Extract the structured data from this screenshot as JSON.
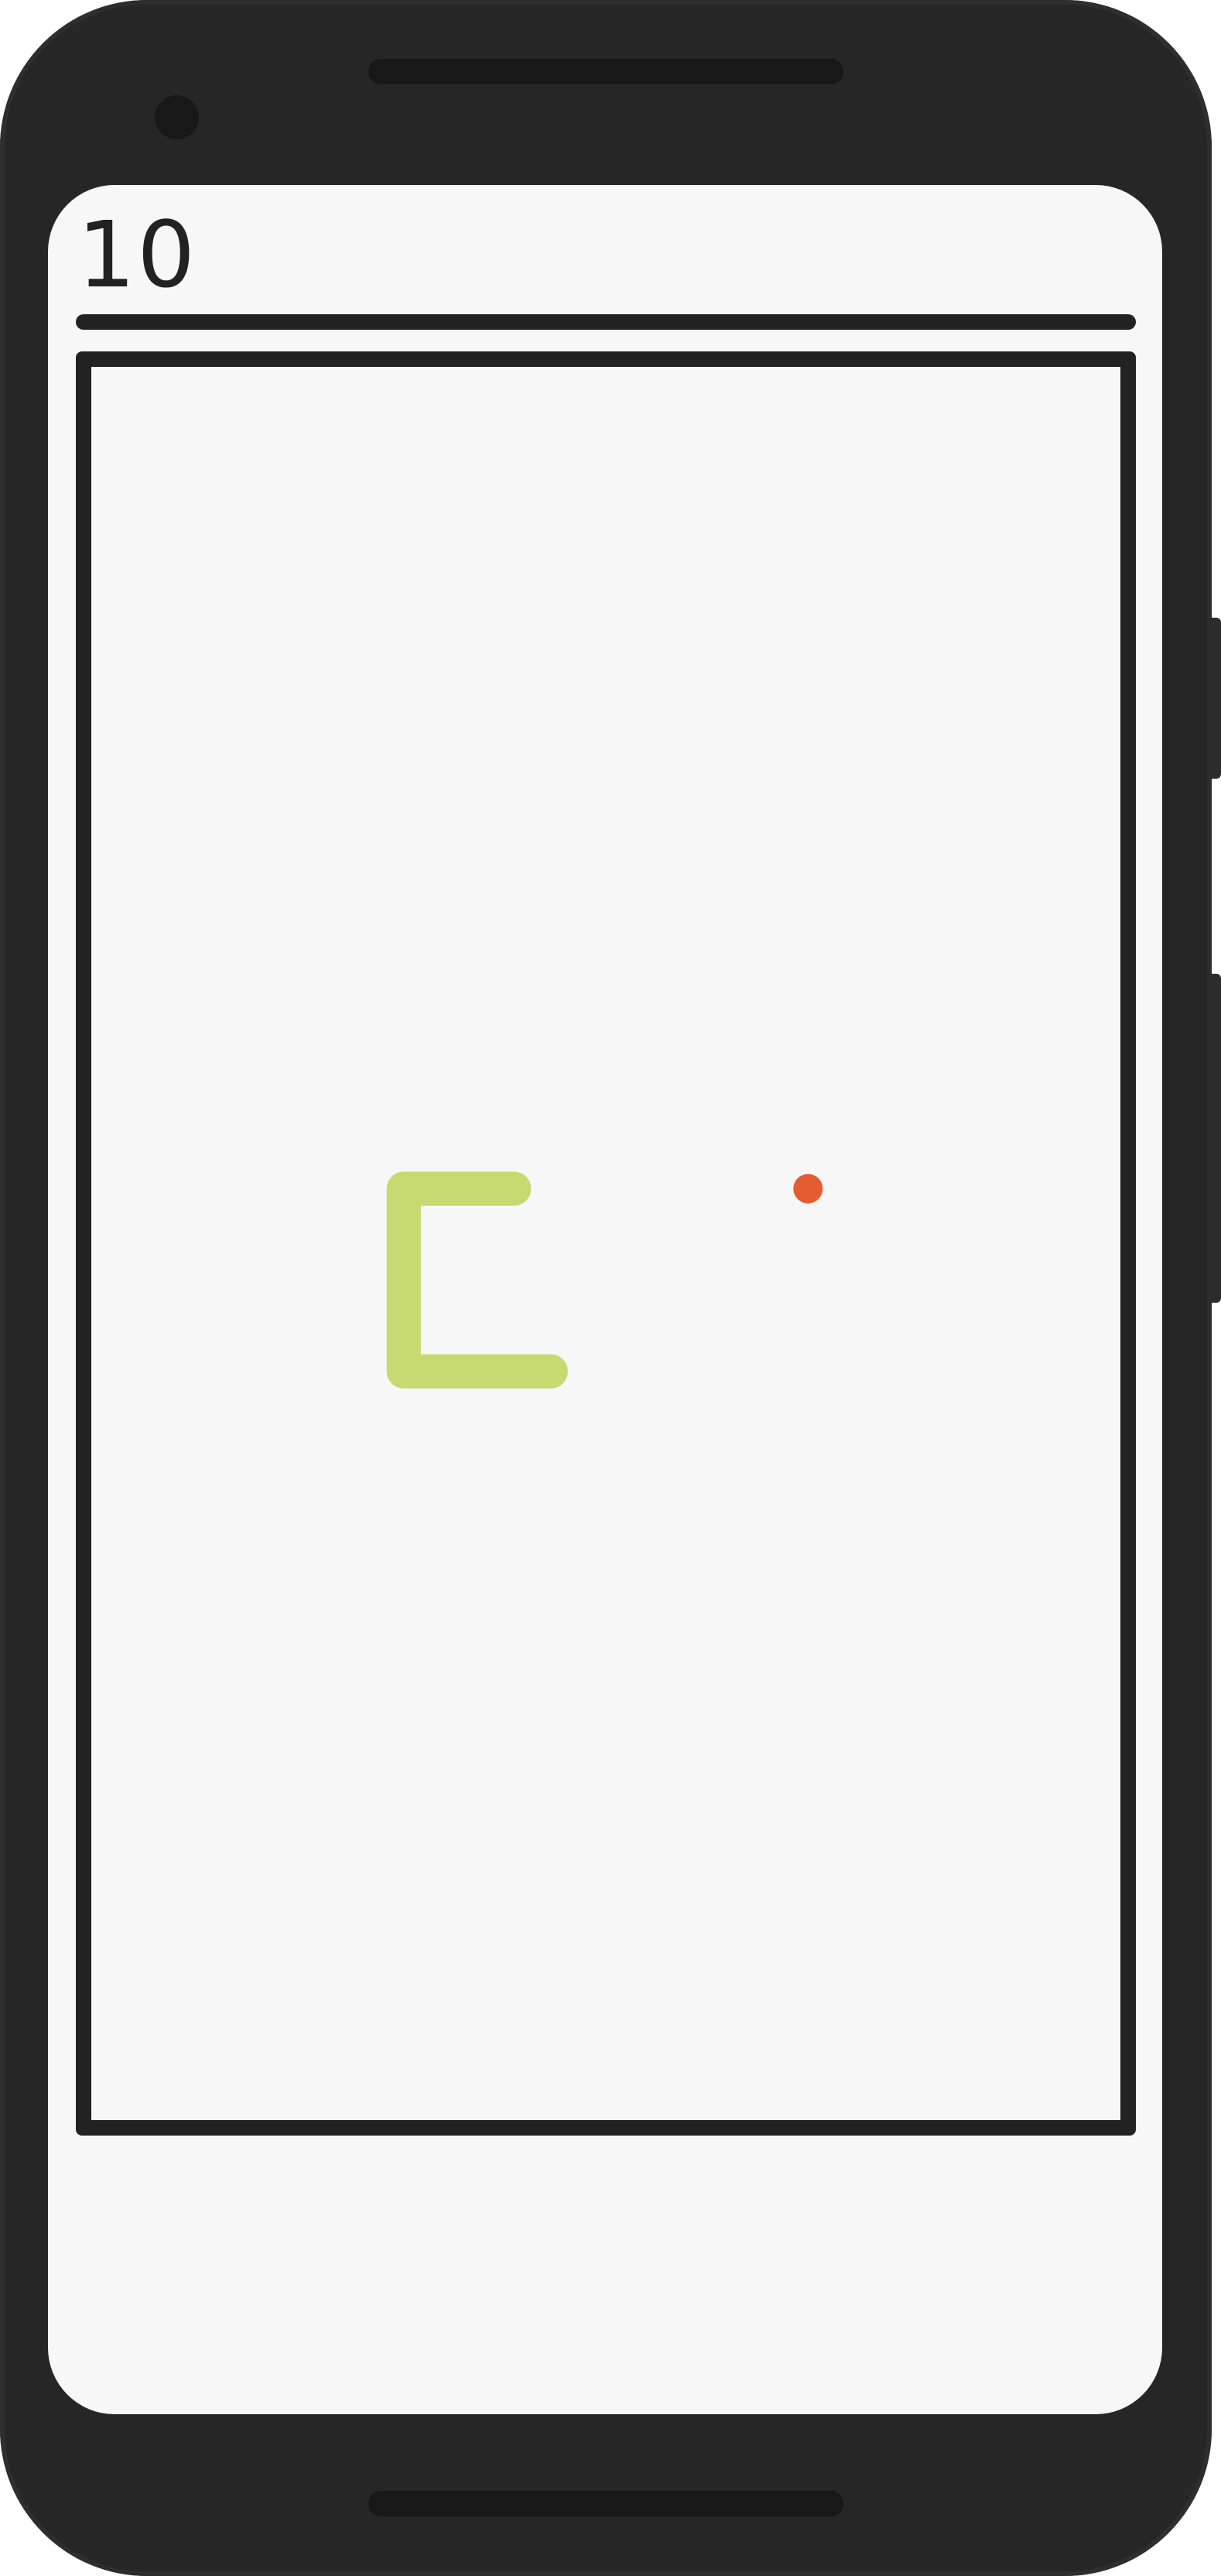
{
  "game": {
    "score": "10"
  },
  "board": {
    "cols": 28,
    "rows": 48,
    "snake_color": "#c6da72",
    "food_color": "#e45d32",
    "border_color": "#222222",
    "snake": [
      [
        12,
        27
      ],
      [
        11,
        27
      ],
      [
        10,
        27
      ],
      [
        9,
        27
      ],
      [
        8,
        27
      ],
      [
        8,
        26
      ],
      [
        8,
        25
      ],
      [
        8,
        24
      ],
      [
        8,
        23
      ],
      [
        8,
        22
      ],
      [
        9,
        22
      ],
      [
        10,
        22
      ],
      [
        11,
        22
      ]
    ],
    "food": [
      19,
      22
    ]
  }
}
